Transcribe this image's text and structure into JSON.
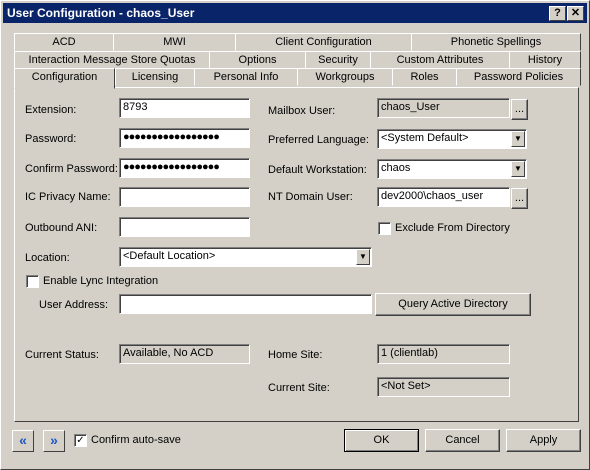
{
  "window": {
    "title": "User Configuration - chaos_User",
    "help_label": "?",
    "close_label": "✕"
  },
  "tabs": {
    "row1": [
      "ACD",
      "MWI",
      "Client Configuration",
      "Phonetic Spellings"
    ],
    "row2": [
      "Interaction Message Store Quotas",
      "Options",
      "Security",
      "Custom Attributes",
      "History"
    ],
    "row3": [
      "Configuration",
      "Licensing",
      "Personal Info",
      "Workgroups",
      "Roles",
      "Password Policies"
    ]
  },
  "form": {
    "extension_label": "Extension:",
    "extension_value": "8793",
    "password_label": "Password:",
    "password_value": "●●●●●●●●●●●●●●●●●",
    "confirm_password_label": "Confirm Password:",
    "confirm_password_value": "●●●●●●●●●●●●●●●●●",
    "ic_privacy_label": "IC Privacy Name:",
    "ic_privacy_value": "",
    "outbound_ani_label": "Outbound ANI:",
    "outbound_ani_value": "",
    "location_label": "Location:",
    "location_value": "<Default Location>",
    "lync_label": "Enable Lync Integration",
    "user_address_label": "User Address:",
    "user_address_value": "",
    "query_ad_label": "Query Active Directory",
    "current_status_label": "Current Status:",
    "current_status_value": "Available, No ACD",
    "mailbox_user_label": "Mailbox User:",
    "mailbox_user_value": "chaos_User",
    "preferred_language_label": "Preferred Language:",
    "preferred_language_value": "<System Default>",
    "default_workstation_label": "Default Workstation:",
    "default_workstation_value": "chaos",
    "nt_domain_user_label": "NT Domain User:",
    "nt_domain_user_value": "dev2000\\chaos_user",
    "exclude_label": "Exclude From Directory",
    "home_site_label": "Home Site:",
    "home_site_value": "1 (clientlab)",
    "current_site_label": "Current Site:",
    "current_site_value": "<Not Set>",
    "browse_label": "..."
  },
  "footer": {
    "prev_label": "«",
    "next_label": "»",
    "confirm_autosave_label": "Confirm auto-save",
    "check_mark": "✓",
    "ok_label": "OK",
    "cancel_label": "Cancel",
    "apply_label": "Apply"
  }
}
